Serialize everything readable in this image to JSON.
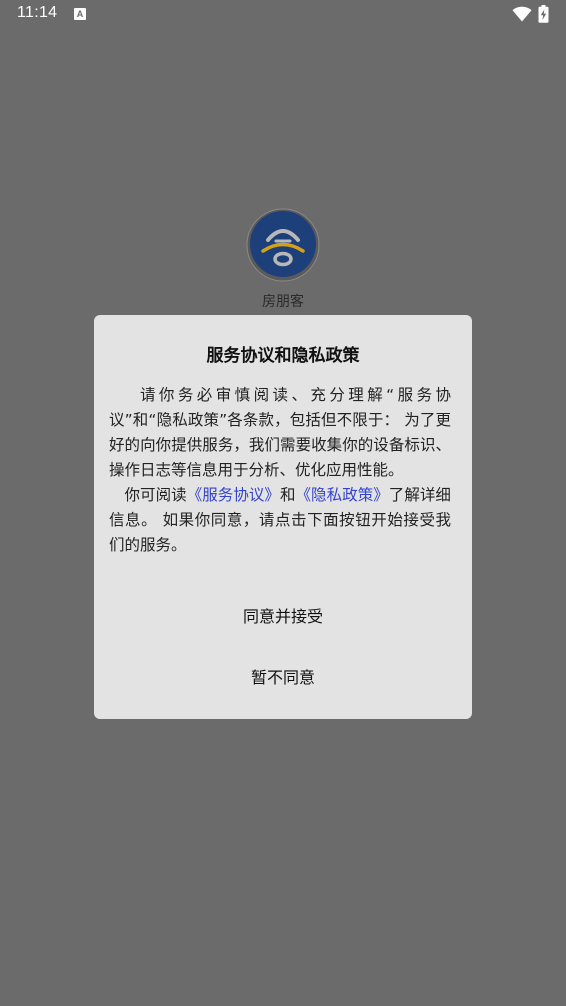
{
  "status_bar": {
    "time": "11:14",
    "notification_glyph": "A",
    "icons": [
      "wifi-icon",
      "battery-charging-icon"
    ]
  },
  "app": {
    "name": "房朋客",
    "logo_icon": "fangpengke-logo",
    "logo_colors": {
      "ring": "#1d3f7a",
      "arc": "#b8b8b8",
      "accent": "#d4a017"
    }
  },
  "dialog": {
    "title": "服务协议和隐私政策",
    "paragraph1": "请你务必审慎阅读、充分理解“服务协议”和“隐私政策”各条款，包括但不限于： 为了更好的向你提供服务，我们需要收集你的设备标识、操作日志等信息用于分析、优化应用性能。",
    "paragraph2": {
      "prefix": "你可阅读",
      "service_link": "《服务协议》",
      "and": "和",
      "privacy_link": "《隐私政策》",
      "suffix": "了解详细信息。 如果你同意，请点击下面按钮开始接受我们的服务。"
    },
    "agree_label": "同意并接受",
    "disagree_label": "暂不同意",
    "link_color": "#3344cc"
  }
}
